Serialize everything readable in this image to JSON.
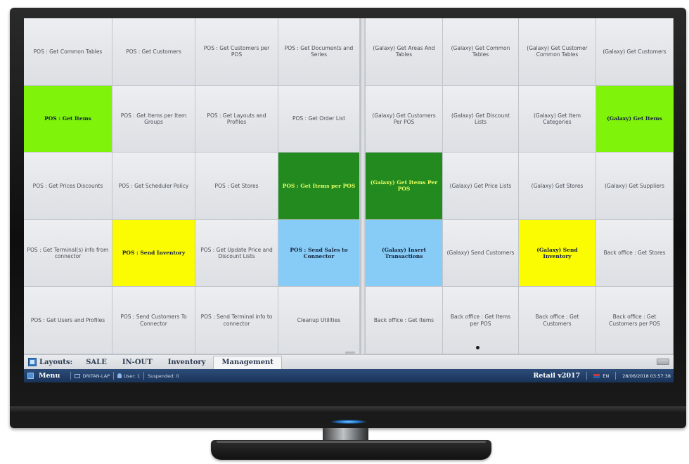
{
  "colors": {
    "light_green": "#80f30a",
    "dark_green": "#228a1f",
    "yellow": "#fbfb02",
    "light_blue": "#87ccf6",
    "default_tile": "#dcdfe3",
    "status_bar": "#1f3b63"
  },
  "tiles_left": [
    {
      "label": "POS : Get Common Tables",
      "color": "default"
    },
    {
      "label": "POS : Get Customers",
      "color": "default"
    },
    {
      "label": "POS : Get Customers per POS",
      "color": "default"
    },
    {
      "label": "POS : Get Documents and Series",
      "color": "default"
    },
    {
      "label": "POS : Get Items",
      "color": "light_green"
    },
    {
      "label": "POS : Get Items per Item Groups",
      "color": "default"
    },
    {
      "label": "POS : Get Layouts and Profiles",
      "color": "default"
    },
    {
      "label": "POS : Get Order List",
      "color": "default"
    },
    {
      "label": "POS : Get Prices Discounts",
      "color": "default"
    },
    {
      "label": "POS : Get Scheduler Policy",
      "color": "default"
    },
    {
      "label": "POS : Get Stores",
      "color": "default"
    },
    {
      "label": "POS : Get Items per POS",
      "color": "dark_green"
    },
    {
      "label": "POS : Get Terminal(s) info from connector",
      "color": "default"
    },
    {
      "label": "POS : Send Inventory",
      "color": "yellow"
    },
    {
      "label": "POS : Get Update Price and Discount Lists",
      "color": "default"
    },
    {
      "label": "POS : Send Sales to Connector",
      "color": "light_blue"
    },
    {
      "label": "POS : Get Users and Profiles",
      "color": "default"
    },
    {
      "label": "POS : Send Customers To Connector",
      "color": "default"
    },
    {
      "label": "POS : Send Terminal info to connector",
      "color": "default"
    },
    {
      "label": "Cleanup Utilities",
      "color": "default"
    }
  ],
  "tiles_right": [
    {
      "label": "(Galaxy) Get Areas And Tables",
      "color": "default"
    },
    {
      "label": "(Galaxy) Get Common Tables",
      "color": "default"
    },
    {
      "label": "(Galaxy) Get Customer Common Tables",
      "color": "default"
    },
    {
      "label": "(Galaxy) Get Customers",
      "color": "default"
    },
    {
      "label": "(Galaxy) Get Customers Per POS",
      "color": "default"
    },
    {
      "label": "(Galaxy) Get Discount Lists",
      "color": "default"
    },
    {
      "label": "(Galaxy) Get Item Categories",
      "color": "default"
    },
    {
      "label": "(Galaxy) Get Items",
      "color": "light_green"
    },
    {
      "label": "(Galaxy) Get Items Per POS",
      "color": "dark_green"
    },
    {
      "label": "(Galaxy) Get Price Lists",
      "color": "default"
    },
    {
      "label": "(Galaxy) Get Stores",
      "color": "default"
    },
    {
      "label": "(Galaxy) Get Suppliers",
      "color": "default"
    },
    {
      "label": "(Galaxy) Insert Transactions",
      "color": "light_blue"
    },
    {
      "label": "(Galaxy) Send Customers",
      "color": "default"
    },
    {
      "label": "(Galaxy) Send Inventory",
      "color": "yellow"
    },
    {
      "label": "Back office : Get Stores",
      "color": "default"
    },
    {
      "label": "Back office : Get Items",
      "color": "default"
    },
    {
      "label": "Back office : Get Items per POS",
      "color": "default"
    },
    {
      "label": "Back office : Get Customers",
      "color": "default"
    },
    {
      "label": "Back office : Get Customers per POS",
      "color": "default"
    }
  ],
  "layouts": {
    "label": "Layouts:",
    "tabs": [
      "SALE",
      "IN-OUT",
      "Inventory",
      "Management"
    ],
    "active_tab": "Management"
  },
  "status_bar": {
    "menu_label": "Menu",
    "computer": "DRITAN-LAP",
    "user": "User: 1",
    "suspended": "Suspended: 0",
    "app_name": "Retail  v2017",
    "language": "EN",
    "datetime": "28/06/2018 03:57:38"
  }
}
